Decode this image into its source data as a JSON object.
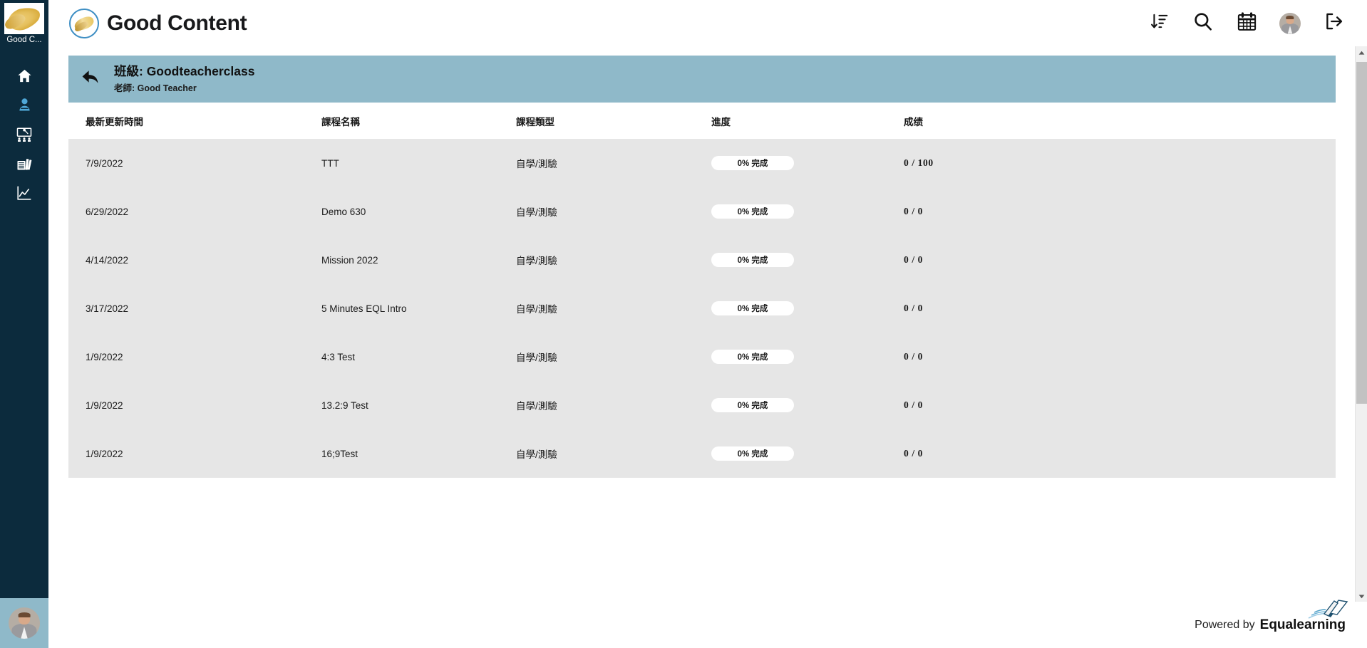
{
  "desktop": {
    "icon_label": "Good C...",
    "icon_name": "wheat-thumbnail"
  },
  "sidebar": {
    "items": [
      {
        "name": "home",
        "icon": "home-icon",
        "active": false
      },
      {
        "name": "profile",
        "icon": "user-icon",
        "active": true
      },
      {
        "name": "classroom",
        "icon": "classroom-icon",
        "active": false
      },
      {
        "name": "library",
        "icon": "books-icon",
        "active": false
      },
      {
        "name": "reports",
        "icon": "chart-line-icon",
        "active": false
      }
    ],
    "user_avatar": "user-avatar"
  },
  "header": {
    "title": "Good Content",
    "logo": "wheat-circle-logo",
    "actions": [
      {
        "name": "sort-button",
        "icon": "sort-descending-icon"
      },
      {
        "name": "search-button",
        "icon": "search-icon"
      },
      {
        "name": "calendar-button",
        "icon": "calendar-icon"
      },
      {
        "name": "account-button",
        "icon": "avatar-icon"
      },
      {
        "name": "logout-button",
        "icon": "logout-icon"
      }
    ]
  },
  "banner": {
    "back_icon": "back-arrow-icon",
    "class_label": "班級: Goodteacherclass",
    "teacher_label": "老師: Good Teacher"
  },
  "table": {
    "columns": [
      {
        "key": "date",
        "label": "最新更新時間"
      },
      {
        "key": "name",
        "label": "課程名稱"
      },
      {
        "key": "type",
        "label": "課程類型"
      },
      {
        "key": "prog",
        "label": "進度"
      },
      {
        "key": "grade",
        "label": "成绩"
      }
    ],
    "rows": [
      {
        "date": "7/9/2022",
        "name": "TTT",
        "type": "自學/測驗",
        "progress": "0% 完成",
        "progress_pct": 0,
        "grade": "0 / 100"
      },
      {
        "date": "6/29/2022",
        "name": "Demo 630",
        "type": "自學/測驗",
        "progress": "0% 完成",
        "progress_pct": 0,
        "grade": "0 / 0"
      },
      {
        "date": "4/14/2022",
        "name": "Mission 2022",
        "type": "自學/測驗",
        "progress": "0% 完成",
        "progress_pct": 0,
        "grade": "0 / 0"
      },
      {
        "date": "3/17/2022",
        "name": "5 Minutes EQL Intro",
        "type": "自學/測驗",
        "progress": "0% 完成",
        "progress_pct": 0,
        "grade": "0 / 0"
      },
      {
        "date": "1/9/2022",
        "name": "4:3 Test",
        "type": "自學/測驗",
        "progress": "0% 完成",
        "progress_pct": 0,
        "grade": "0 / 0"
      },
      {
        "date": "1/9/2022",
        "name": "13.2:9 Test",
        "type": "自學/測驗",
        "progress": "0% 完成",
        "progress_pct": 0,
        "grade": "0 / 0"
      },
      {
        "date": "1/9/2022",
        "name": "16;9Test",
        "type": "自學/測驗",
        "progress": "0% 完成",
        "progress_pct": 0,
        "grade": "0 / 0"
      }
    ]
  },
  "scrollbar": {
    "up_icon": "triangle-up-icon",
    "down_icon": "triangle-down-icon"
  },
  "footer": {
    "powered_by": "Powered by",
    "brand": "Equalearning",
    "logo": "open-book-icon"
  },
  "colors": {
    "sidebar_bg": "#0c2b3d",
    "banner_bg": "#8fb9c9",
    "row_bg": "#e6e6e6",
    "accent_blue": "#3f8fc4",
    "active_nav": "#4fa8d8"
  }
}
